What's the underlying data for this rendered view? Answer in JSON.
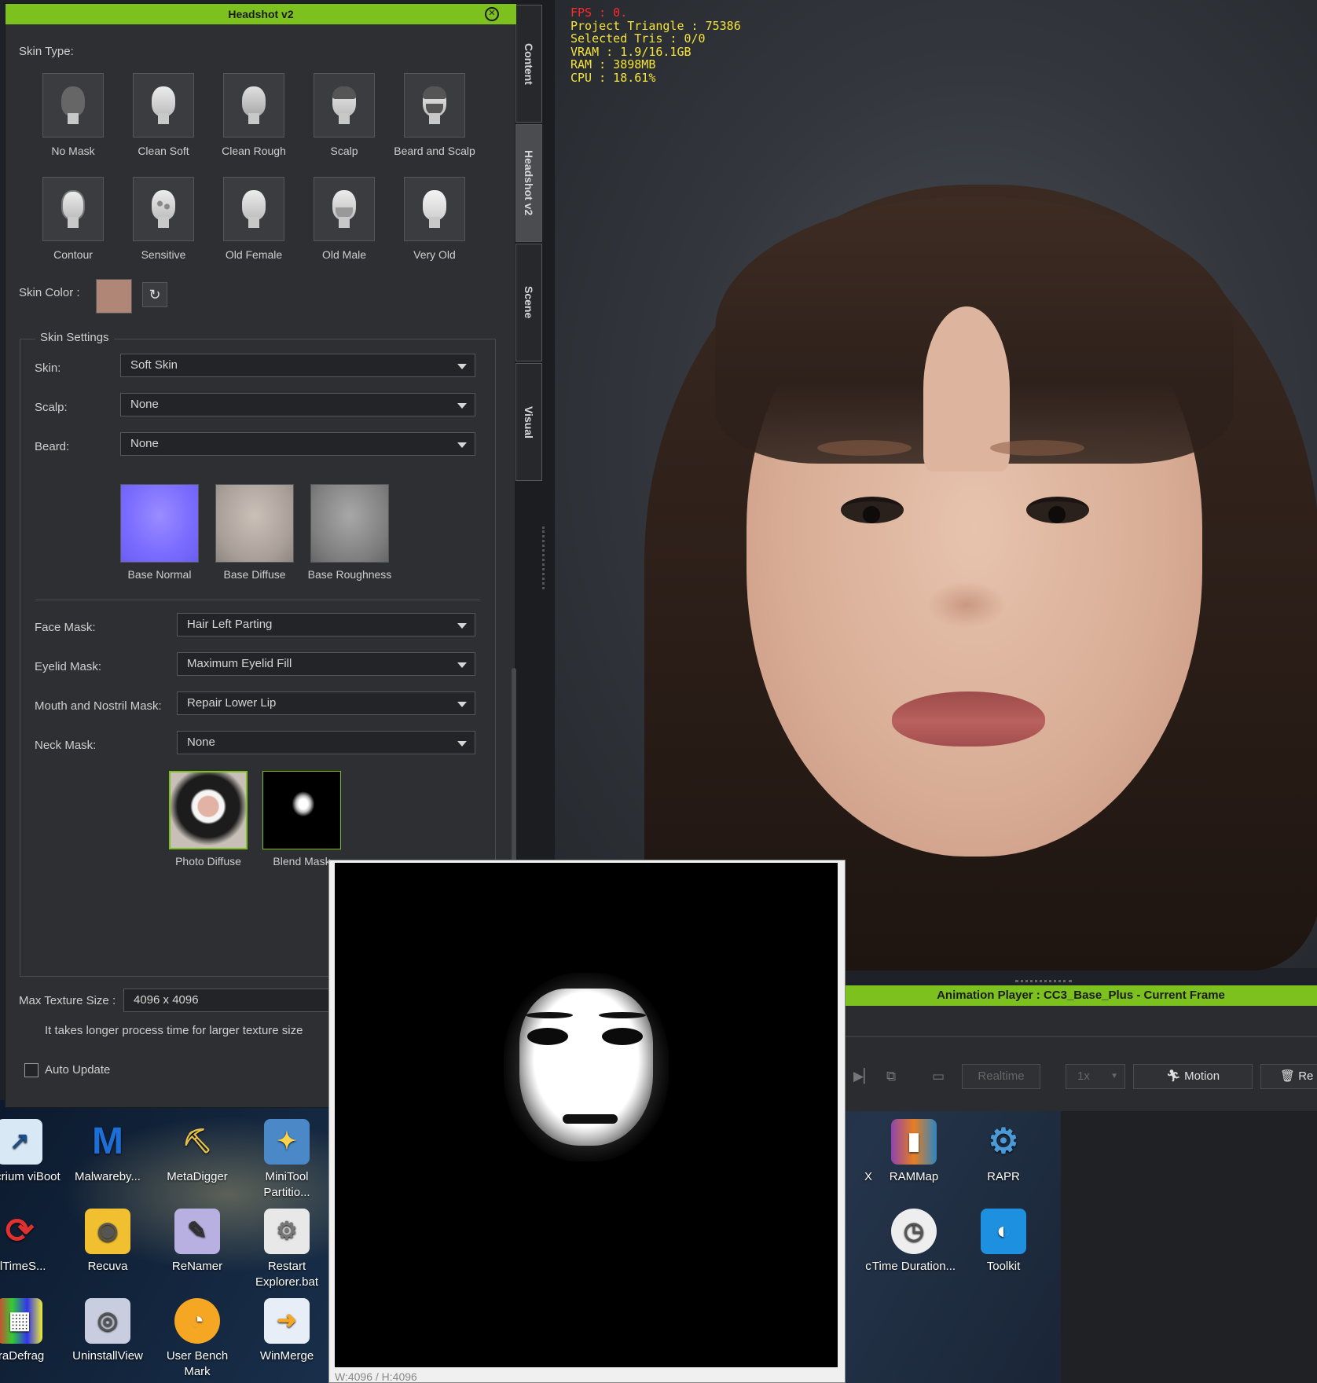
{
  "viewport": {
    "stats": {
      "fps": "FPS : 0.",
      "triangles": "Project Triangle : 75386",
      "selected": "Selected Tris : 0/0",
      "vram": "VRAM : 1.9/16.1GB",
      "ram": "RAM : 3898MB",
      "cpu": "CPU : 18.61%"
    }
  },
  "side_tabs": [
    "Content",
    "Headshot v2",
    "Scene",
    "Visual"
  ],
  "panel": {
    "title": "Headshot v2",
    "skin_type_label": "Skin Type:",
    "skin_types_row1": [
      "No Mask",
      "Clean Soft",
      "Clean Rough",
      "Scalp",
      "Beard and Scalp"
    ],
    "skin_types_row2": [
      "Contour",
      "Sensitive",
      "Old Female",
      "Old Male",
      "Very Old"
    ],
    "skin_color_label": "Skin Color :",
    "skin_color": "#b08676",
    "skin_settings": {
      "title": "Skin Settings",
      "skin_label": "Skin:",
      "skin_value": "Soft Skin",
      "scalp_label": "Scalp:",
      "scalp_value": "None",
      "beard_label": "Beard:",
      "beard_value": "None",
      "thumbs": [
        "Base Normal",
        "Base Diffuse",
        "Base Roughness"
      ],
      "face_mask_label": "Face Mask:",
      "face_mask_value": "Hair Left Parting",
      "eyelid_mask_label": "Eyelid Mask:",
      "eyelid_mask_value": "Maximum Eyelid Fill",
      "mouth_mask_label": "Mouth and Nostril Mask:",
      "mouth_mask_value": "Repair Lower Lip",
      "neck_mask_label": "Neck Mask:",
      "neck_mask_value": "None",
      "photo_thumbs": [
        "Photo Diffuse",
        "Blend Mask"
      ]
    },
    "max_texture_label": "Max Texture Size :",
    "max_texture_value": "4096 x 4096",
    "note": "It takes longer process time for larger texture size",
    "auto_update_label": "Auto Update",
    "auto_update_checked": false
  },
  "animation_player": {
    "title": "Animation Player : CC3_Base_Plus - Current Frame",
    "realtime": "Realtime",
    "speed": "1x",
    "motion": "Motion",
    "reset": "Re"
  },
  "preview": {
    "caption": "W:4096 / H:4096"
  },
  "desktop_icons": [
    {
      "label": "Macrium viBoot",
      "icon": "macrium-icon"
    },
    {
      "label": "Malwareby...",
      "icon": "malwarebytes-icon"
    },
    {
      "label": "MetaDigger",
      "icon": "metadigger-icon"
    },
    {
      "label": "MiniTool Partitio...",
      "icon": "minitool-icon"
    },
    {
      "label": "alTimeS...",
      "icon": "realtimesync-icon"
    },
    {
      "label": "Recuva",
      "icon": "recuva-icon"
    },
    {
      "label": "ReNamer",
      "icon": "renamer-icon"
    },
    {
      "label": "Restart Explorer.bat",
      "icon": "batch-file-icon"
    },
    {
      "label": "traDefrag",
      "icon": "ultradefrag-icon"
    },
    {
      "label": "UninstallView",
      "icon": "uninstallview-icon"
    },
    {
      "label": "User Bench Mark",
      "icon": "userbenchmark-icon"
    },
    {
      "label": "WinMerge",
      "icon": "winmerge-icon"
    },
    {
      "label": "X",
      "icon": "partial-icon"
    },
    {
      "label": "RAMMap",
      "icon": "rammap-icon"
    },
    {
      "label": "RAPR",
      "icon": "rapr-icon"
    },
    {
      "label": "c",
      "icon": "partial-icon"
    },
    {
      "label": "Time Duration...",
      "icon": "clock-icon"
    },
    {
      "label": "Toolkit",
      "icon": "toolkit-icon"
    }
  ]
}
